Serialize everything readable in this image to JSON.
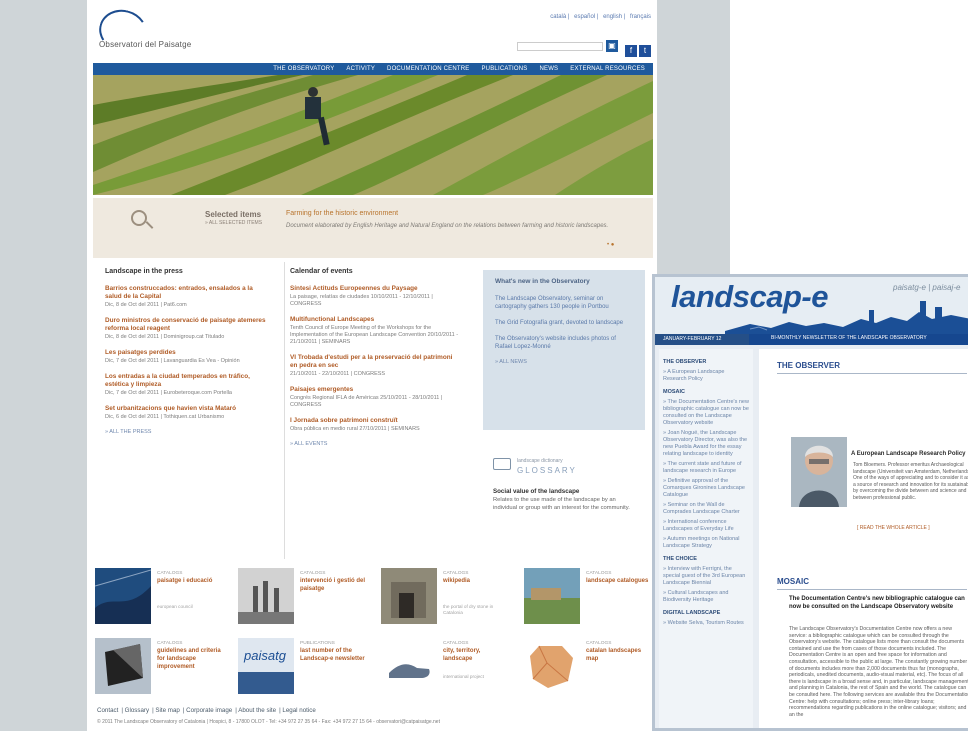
{
  "site": {
    "logo_text": "Observatori del Paisatge",
    "languages": [
      "català",
      "español",
      "english",
      "français"
    ],
    "search_placeholder": "",
    "nav": [
      "THE OBSERVATORY",
      "ACTIVITY",
      "DOCUMENTATION CENTRE",
      "PUBLICATIONS",
      "NEWS",
      "EXTERNAL RESOURCES"
    ],
    "selected": {
      "title": "Selected items",
      "link": "» ALL SELECTED ITEMS",
      "headline": "Farming for the historic environment",
      "description": "Document elaborated by English Heritage and Natural England on the relations between farming and historic landscapes.",
      "dots": "• ●"
    },
    "press": {
      "title": "Landscape in the press",
      "items": [
        {
          "title": "Barrios construccados: entrados, ensalados a la salud de la Capital",
          "meta": "Dic, 8 de Oct del 2011 | Pat6.com"
        },
        {
          "title": "Duro ministros de conservació de paisatge atemeres reforma local reagent",
          "meta": "Dic, 8 de Oct del 2011 | Dominigroup.cat Titulado"
        },
        {
          "title": "Les paisatges perdides",
          "meta": "Dic, 7 de Oct del 2011 | Lavanguardia Es Vea - Opinión"
        },
        {
          "title": "Los entradas a la ciudad temperados en tráfico, estética y limpieza",
          "meta": "Dic, 7 de Oct del 2011 | Eurobeteroque.com Portella"
        },
        {
          "title": "Set urbanitzacions que havien vista Mataró",
          "meta": "Dic, 6 de Oct del 2011 | Tothiquen.cat Urbanismo"
        }
      ],
      "all_link": "» ALL THE PRESS"
    },
    "calendar": {
      "title": "Calendar of events",
      "items": [
        {
          "title": "Síntesi Actituds Europeennes du Paysage",
          "meta": "La paisage, relatías de ciudades 10/10/2011 - 12/10/2011 | CONGRESS"
        },
        {
          "title": "Multifunctional Landscapes",
          "meta": "Tenth Council of Europe Meeting of the Workshops for the Implementation of the European Landscape Convention 20/10/2011 - 21/10/2011 | SEMINARS"
        },
        {
          "title": "VI Trobada d'estudi per a la preservació del patrimoni en pedra en sec",
          "meta": "21/10/2011 - 22/10/2011 | CONGRESS"
        },
        {
          "title": "Paisajes emergentes",
          "meta": "Congrés Regional IFLA de Américas 25/10/2011 - 28/10/2011 | CONGRESS"
        },
        {
          "title": "I Jornada sobre patrimoni construït",
          "meta": "Obra pública en medio rural 27/10/2011 | SEMINARS"
        }
      ],
      "all_link": "» ALL EVENTS"
    },
    "whats_new": {
      "title": "What's new in the Observatory",
      "items": [
        "The Landscape Observatory, seminar on cartography gathers 130 people in Portbou",
        "The Grid Fotografía grant, devoted to landscape",
        "The Observatory's website includes photos of Rafael Lopez-Monné"
      ],
      "all_link": "» ALL NEWS"
    },
    "glossary": {
      "small": "landscape dictionary",
      "big": "GLOSSARY",
      "term": "Social value of the landscape",
      "definition": "Relates to the use made of the landscape by an individual or group with an interest for the community."
    },
    "tiles": [
      {
        "category": "catalogs",
        "title": "paisatge i educació",
        "subtitle": "european council"
      },
      {
        "category": "catalogs",
        "title": "intervenció i gestió del paisatge",
        "subtitle": ""
      },
      {
        "category": "catalogs",
        "title": "wikipedia",
        "subtitle": "the portal of dry stone in Catalonia"
      },
      {
        "category": "catalogs",
        "title": "landscape catalogues",
        "subtitle": ""
      },
      {
        "category": "catalogs",
        "title": "guidelines and criteria for landscape improvement",
        "subtitle": ""
      },
      {
        "category": "publications",
        "title": "last number of the Landscap-e newsletter",
        "subtitle": ""
      },
      {
        "category": "catalogs",
        "title": "city, territory, landscape",
        "subtitle": "international project"
      },
      {
        "category": "catalogs",
        "title": "catalan landscapes map",
        "subtitle": ""
      }
    ],
    "footer_links": [
      "Contact",
      "Glossary",
      "Site map",
      "Corporate image",
      "About the site",
      "Legal notice"
    ],
    "copyright": "© 2011 The Landscape Observatory of Catalonia | Hospici, 8 - 17800 OLOT - Tel: +34 972 27 35 64 - Fax: +34 972 27 15 64 - observatori@catpaisatge.net"
  },
  "landscape_e": {
    "logo": "landscap-e",
    "tagline": "paisatg-e | paisaj-e",
    "date": "JANUARY-FEBRUARY 12",
    "description": "BI-MONTHLY NEWSLETTER OF THE LANDSCAPE OBSERVATORY",
    "sidebar": [
      {
        "heading": "THE OBSERVER",
        "items": [
          "» A European Landscape Research Policy"
        ]
      },
      {
        "heading": "MOSAIC",
        "items": [
          "» The Documentation Centre's new bibliographic catalogue can now be consulted on the Landscape Observatory website",
          "» Joan Nogué, the Landscape Observatory Director, was also the new Puebla Award for the essay relating landscape to identity",
          "» The current state and future of landscape research in Europe",
          "» Definitive approval of the Comarques Gironines Landscape Catalogue",
          "» Seminar on the Wall de Comprades Landscape Charter",
          "» International conference Landscapes of Everyday Life",
          "» Autumn meetings on National Landscape Strategy"
        ]
      },
      {
        "heading": "THE CHOICE",
        "items": [
          "» Interview with Ferrigni, the special guest of the 3rd European Landscape Biennial",
          "» Cultural Landscapes and Biodiversity Heritage"
        ]
      },
      {
        "heading": "DIGITAL LANDSCAPE",
        "items": [
          "» Website Selva, Tourism Routes"
        ]
      }
    ],
    "observer": {
      "section": "THE OBSERVER",
      "title": "A European Landscape Research Policy",
      "text": "Tom Bloemers. Professor emeritus Archaeological landscape (Universiteit van Amsterdam, Netherlands). One of the ways of appreciating and to consider it as a source of research and innovation for its sustainable by overcoming the divide between and science and between professional public.",
      "link": "[ READ THE WHOLE ARTICLE ]"
    },
    "mosaic": {
      "section": "MOSAIC",
      "title": "The Documentation Centre's new bibliographic catalogue can now be consulted on the Landscape Observatory website",
      "text": "The Landscape Observatory's Documentation Centre now offers a new service: a bibliographic catalogue which can be consulted through the Observatory's website. The catalogue lists more than consult the documents contained and use the from cases of those documents included. The Documentation Centre is an open and free space for information and consultation, accessible to the public at large. The constantly growing number of documents includes more than 2,000 documents thus far (monographs, periodicals, unedited documents, audio-visual material, etc). The focus of all there is landscape in a broad sense and, in particular, landscape management and planning in Catalonia, the rest of Spain and the world. The catalogue can be consulted here. The following services are available thru the Documentation Centre: help with consultations; online press; inter-library loans; recommendations regarding publications in the online catalogue; visitors; and an the"
    }
  }
}
